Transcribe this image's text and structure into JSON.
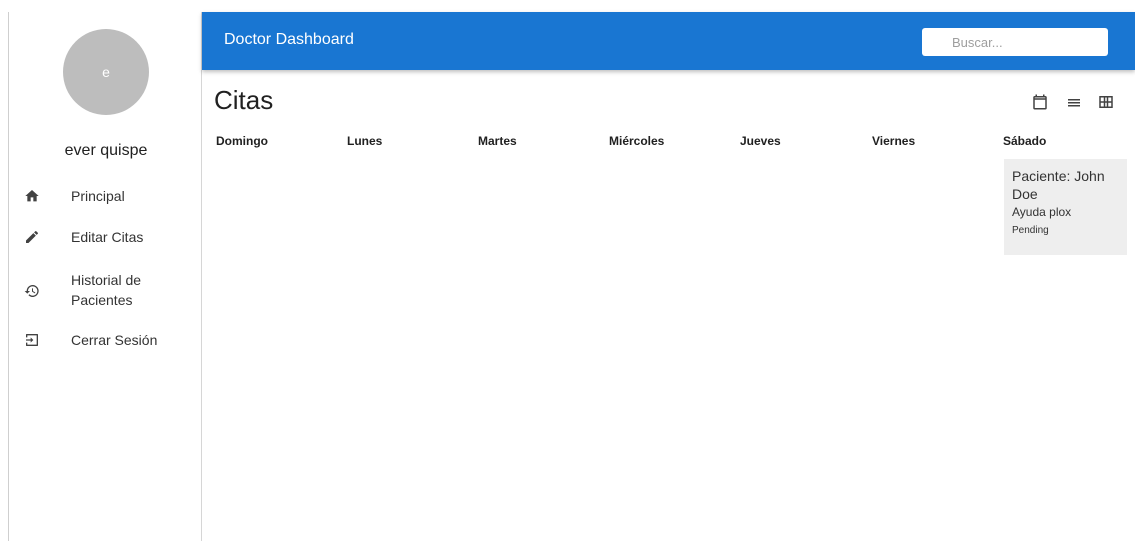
{
  "header": {
    "title": "Doctor Dashboard",
    "search_placeholder": "Buscar...",
    "search_value": "",
    "background_color": "#1976d2"
  },
  "sidebar": {
    "avatar_initial": "e",
    "username": "ever quispe",
    "items": [
      {
        "label": "Principal",
        "icon": "home-icon"
      },
      {
        "label": "Editar Citas",
        "icon": "pencil-icon"
      },
      {
        "label": "Historial de Pacientes",
        "icon": "history-icon"
      },
      {
        "label": "Cerrar Sesión",
        "icon": "logout-icon"
      }
    ]
  },
  "main": {
    "title": "Citas",
    "view_icons": [
      "calendar-icon",
      "list-icon",
      "grid-icon"
    ],
    "days": [
      "Domingo",
      "Lunes",
      "Martes",
      "Miércoles",
      "Jueves",
      "Viernes",
      "Sábado"
    ],
    "appointments": [
      {
        "day": "Sábado",
        "patient": "Paciente: John Doe",
        "description": "Ayuda plox",
        "status": "Pending"
      }
    ]
  }
}
